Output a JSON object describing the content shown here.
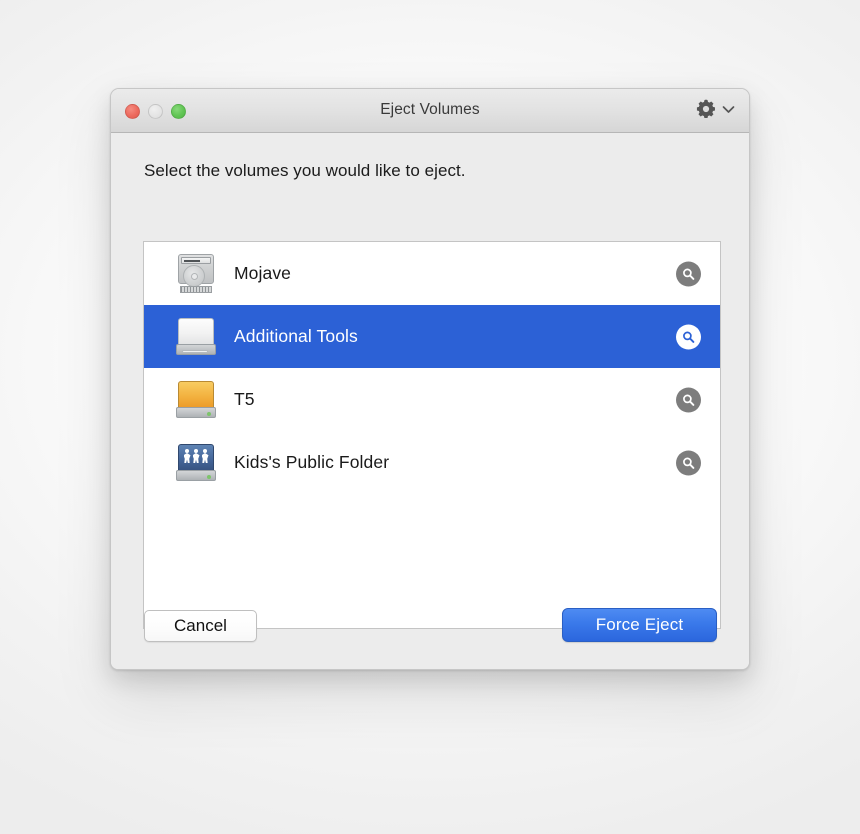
{
  "window": {
    "title": "Eject Volumes",
    "traffic_lights": [
      {
        "name": "close",
        "color": "#ed6a5e"
      },
      {
        "name": "minimize",
        "color": "#e4e4e4"
      },
      {
        "name": "zoom",
        "color": "#61c554"
      }
    ],
    "gear_menu": {
      "icon": "gear-icon",
      "chevron": "chevron-down-icon"
    }
  },
  "instruction": "Select the volumes you would like to eject.",
  "list": {
    "rows": [
      {
        "label": "Mojave",
        "icon": "internal-hard-disk-icon",
        "icon_style": "hdd",
        "selected": false,
        "reveal_icon": "magnifier-icon"
      },
      {
        "label": "Additional Tools",
        "icon": "external-drive-icon",
        "icon_style": "white",
        "selected": true,
        "reveal_icon": "magnifier-icon"
      },
      {
        "label": "T5",
        "icon": "external-drive-icon",
        "icon_style": "amber",
        "selected": false,
        "reveal_icon": "magnifier-icon"
      },
      {
        "label": "Kids's Public Folder",
        "icon": "network-share-icon",
        "icon_style": "network",
        "selected": false,
        "reveal_icon": "magnifier-icon"
      }
    ]
  },
  "buttons": {
    "cancel_label": "Cancel",
    "force_eject_label": "Force Eject"
  },
  "colors": {
    "selection_blue": "#2c61d6",
    "default_button_blue": "#3a79ea",
    "window_background": "#ececec",
    "list_background": "#ffffff"
  }
}
